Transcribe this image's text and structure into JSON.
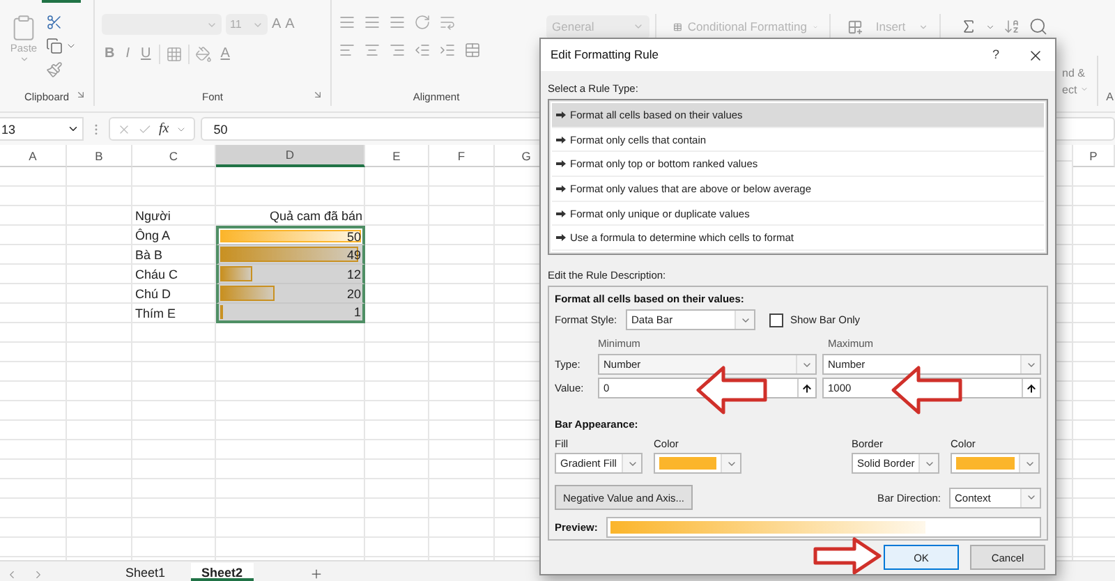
{
  "ribbon": {
    "clipboard": {
      "paste": "Paste",
      "label": "Clipboard"
    },
    "font": {
      "size": "11",
      "grow": "A",
      "shrink": "A",
      "bold": "B",
      "italic": "I",
      "underline": "U",
      "font_color": "A",
      "label": "Font"
    },
    "alignment": {
      "label": "Alignment"
    },
    "number_format": "General",
    "styles": {
      "conditional_formatting": "Conditional Formatting"
    },
    "cells": {
      "insert": "Insert"
    },
    "editing": {
      "find_select": [
        "nd &",
        "ect"
      ]
    },
    "next_group": "A"
  },
  "formula_bar": {
    "name_box": "13",
    "fx": "fx",
    "value": "50"
  },
  "sheet": {
    "columns": [
      {
        "label": "A",
        "selected": false
      },
      {
        "label": "B",
        "selected": false
      },
      {
        "label": "C",
        "selected": false
      },
      {
        "label": "D",
        "selected": true
      },
      {
        "label": "E",
        "selected": false
      },
      {
        "label": "F",
        "selected": false
      },
      {
        "label": "G",
        "selected": false
      }
    ],
    "far_column": "P",
    "header": {
      "name": "Người",
      "value": "Quả cam đã bán"
    },
    "rows": [
      {
        "name": "Ông A",
        "value": "50",
        "level": 1,
        "active": true
      },
      {
        "name": "Bà B",
        "value": "49",
        "level": 0.98,
        "active": false
      },
      {
        "name": "Cháu C",
        "value": "12",
        "level": 0.24,
        "active": false
      },
      {
        "name": "Chú D",
        "value": "20",
        "level": 0.4,
        "active": false
      },
      {
        "name": "Thím E",
        "value": "1",
        "level": 0.02,
        "active": false
      }
    ]
  },
  "sheet_tabs": [
    {
      "label": "Sheet1",
      "selected": false
    },
    {
      "label": "Sheet2",
      "selected": true
    }
  ],
  "dialog": {
    "title": "Edit Formatting Rule",
    "help": "?",
    "rule_type_label": "Select a Rule Type:",
    "rule_types": [
      {
        "label": "Format all cells based on their values",
        "selected": true
      },
      {
        "label": "Format only cells that contain",
        "selected": false
      },
      {
        "label": "Format only top or bottom ranked values",
        "selected": false
      },
      {
        "label": "Format only values that are above or below average",
        "selected": false
      },
      {
        "label": "Format only unique or duplicate values",
        "selected": false
      },
      {
        "label": "Use a formula to determine which cells to format",
        "selected": false
      }
    ],
    "description_label": "Edit the Rule Description:",
    "description": {
      "heading": "Format all cells based on their values:",
      "format_style": {
        "label": "Format Style:",
        "value": "Data Bar"
      },
      "show_bar_only": {
        "label": "Show Bar Only",
        "checked": false
      },
      "type_label": "Type:",
      "value_label": "Value:",
      "minimum": {
        "heading": "Minimum",
        "type": "Number",
        "value": "0"
      },
      "maximum": {
        "heading": "Maximum",
        "type": "Number",
        "value": "1000"
      },
      "bar_appearance": {
        "heading": "Bar Appearance:",
        "fill": {
          "label": "Fill",
          "value": "Gradient Fill"
        },
        "fill_color": {
          "label": "Color",
          "color": "#fbb52b"
        },
        "border": {
          "label": "Border",
          "value": "Solid Border"
        },
        "border_color": {
          "label": "Color",
          "color": "#fbb52b"
        },
        "negative_button": "Negative Value and Axis...",
        "bar_direction": {
          "label": "Bar Direction:",
          "value": "Context"
        }
      },
      "preview": {
        "label": "Preview:",
        "level": 0.74
      }
    },
    "buttons": [
      {
        "label": "OK",
        "default": true
      },
      {
        "label": "Cancel",
        "default": false
      }
    ]
  }
}
